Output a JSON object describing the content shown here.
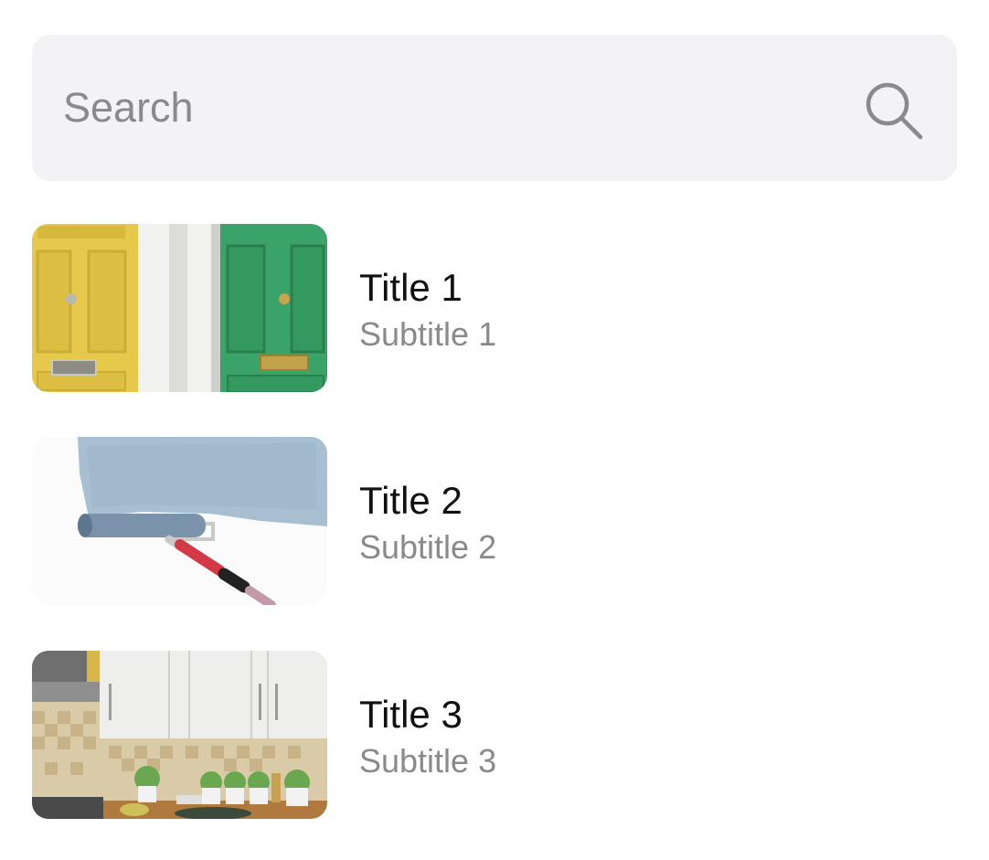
{
  "search": {
    "placeholder": "Search",
    "value": "",
    "icon": "search-icon"
  },
  "list": {
    "items": [
      {
        "title": "Title 1",
        "subtitle": "Subtitle 1",
        "image": "doors-image"
      },
      {
        "title": "Title 2",
        "subtitle": "Subtitle 2",
        "image": "paint-roller-image"
      },
      {
        "title": "Title 3",
        "subtitle": "Subtitle 3",
        "image": "kitchen-image"
      }
    ]
  },
  "colors": {
    "search_background": "#f3f3f5",
    "placeholder": "#8a8a8e",
    "title": "#111111",
    "subtitle": "#8a8a8e"
  }
}
